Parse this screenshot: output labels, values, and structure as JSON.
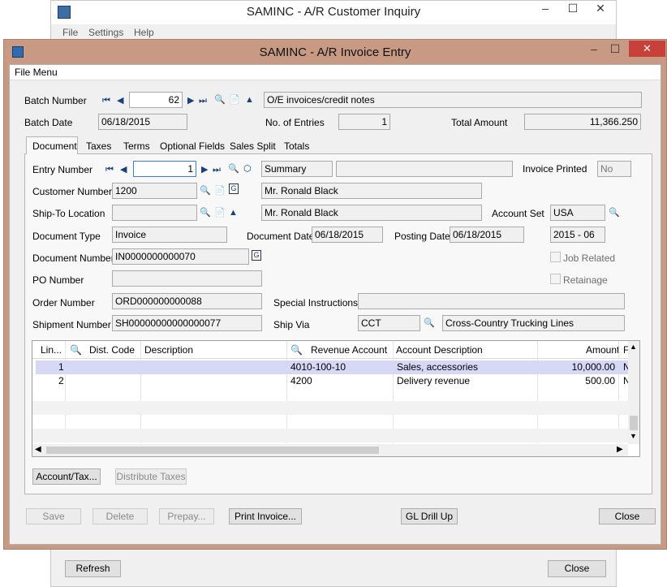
{
  "bg_window": {
    "title": "SAMINC - A/R Customer Inquiry",
    "menu": [
      "File",
      "Settings",
      "Help"
    ],
    "refresh_label": "Refresh",
    "close_label": "Close"
  },
  "window": {
    "title": "SAMINC - A/R Invoice Entry",
    "file_menu": "File Menu"
  },
  "batch": {
    "number_label": "Batch Number",
    "number": "62",
    "description": "O/E invoices/credit notes",
    "date_label": "Batch Date",
    "date": "06/18/2015",
    "entries_label": "No. of Entries",
    "entries": "1",
    "total_label": "Total Amount",
    "total": "11,366.250"
  },
  "tabs": [
    "Document",
    "Taxes",
    "Terms",
    "Optional Fields",
    "Sales Split",
    "Totals"
  ],
  "document": {
    "entry_label": "Entry Number",
    "entry": "1",
    "entry_type": "Summary",
    "invoice_printed_label": "Invoice Printed",
    "invoice_printed": "No",
    "customer_label": "Customer Number",
    "customer": "1200",
    "customer_name": "Mr. Ronald Black",
    "shipto_label": "Ship-To Location",
    "shipto": "",
    "shipto_name": "Mr. Ronald Black",
    "account_set_label": "Account Set",
    "account_set": "USA",
    "doc_type_label": "Document Type",
    "doc_type": "Invoice",
    "doc_date_label": "Document Date",
    "doc_date": "06/18/2015",
    "posting_date_label": "Posting Date",
    "posting_date": "06/18/2015",
    "period": "2015 - 06",
    "doc_number_label": "Document Number",
    "doc_number": "IN0000000000070",
    "job_related_label": "Job Related",
    "po_label": "PO Number",
    "po": "",
    "retainage_label": "Retainage",
    "order_label": "Order Number",
    "order": "ORD000000000088",
    "special_label": "Special Instructions",
    "special": "",
    "shipment_label": "Shipment Number",
    "shipment": "SH00000000000000077",
    "shipvia_label": "Ship Via",
    "shipvia": "CCT",
    "shipvia_name": "Cross-Country Trucking Lines"
  },
  "grid": {
    "headers": [
      "Lin...",
      "Dist. Code",
      "Description",
      "Revenue Account",
      "Account Description",
      "Amount",
      "F"
    ],
    "rows": [
      {
        "line": "1",
        "dist": "",
        "desc": "",
        "account": "4010-100-10",
        "acct_desc": "Sales, accessories",
        "amount": "10,000.00",
        "f": "N"
      },
      {
        "line": "2",
        "dist": "",
        "desc": "",
        "account": "4200",
        "acct_desc": "Delivery revenue",
        "amount": "500.00",
        "f": "N"
      }
    ]
  },
  "buttons": {
    "account_tax": "Account/Tax...",
    "distribute": "Distribute Taxes",
    "save": "Save",
    "delete": "Delete",
    "prepay": "Prepay...",
    "print": "Print Invoice...",
    "gl_drill": "GL Drill Up",
    "close": "Close"
  },
  "colors": {
    "frame": "#c89a84",
    "close_red": "#c7413a",
    "selected_row": "#d6d8f5"
  }
}
